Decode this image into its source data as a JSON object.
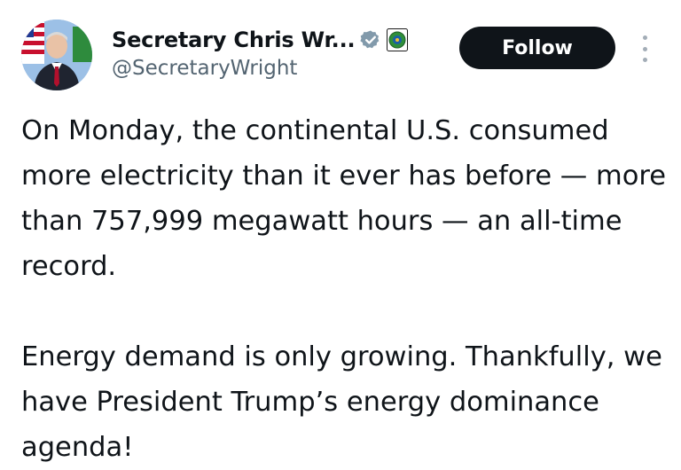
{
  "profile": {
    "display_name": "Secretary Chris Wr...",
    "handle": "@SecretaryWright",
    "verified_badge_icon": "verified-badge-icon",
    "affiliation_badge_icon": "department-seal-icon",
    "avatar_icon": "avatar-photo"
  },
  "actions": {
    "follow_label": "Follow",
    "more_icon": "more-vertical-icon"
  },
  "tweet": {
    "paragraphs": [
      "On Monday, the continental U.S. consumed more electricity than it ever has before — more than 757,999 megawatt hours — an all-time record.",
      "Energy demand is only growing. Thankfully, we have President Trump’s energy dominance agenda!"
    ]
  },
  "colors": {
    "text": "#0f1419",
    "secondary_text": "#536471",
    "follow_bg": "#0f1419",
    "verified": "#829aab"
  }
}
